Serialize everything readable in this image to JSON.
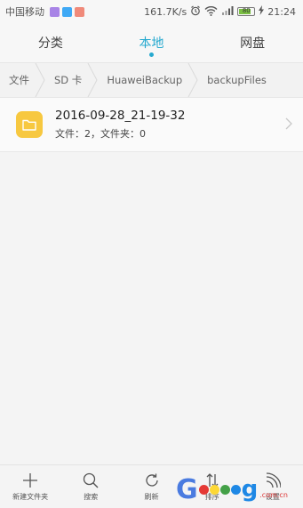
{
  "status_bar": {
    "carrier": "中国移动",
    "notification_colors": [
      "#a884e6",
      "#3fa9f5",
      "#f08a7a"
    ],
    "network_speed": "161.7K/s",
    "battery_level_text": "80",
    "battery_level": 0.8,
    "time": "21:24"
  },
  "tabs": {
    "items": [
      {
        "label": "分类"
      },
      {
        "label": "本地"
      },
      {
        "label": "网盘"
      }
    ],
    "active": "本地",
    "accent_color": "#26a9cf"
  },
  "breadcrumb": {
    "items": [
      "文件",
      "SD 卡",
      "HuaweiBackup",
      "backupFiles"
    ]
  },
  "files": [
    {
      "name": "2016-09-28_21-19-32",
      "meta": "文件：2，文件夹：0",
      "icon": "folder-icon",
      "icon_color": "#f7c840"
    }
  ],
  "toolbar": {
    "items": [
      {
        "label": "新建文件夹",
        "icon": "plus-icon"
      },
      {
        "label": "搜索",
        "icon": "search-icon"
      },
      {
        "label": "刷新",
        "icon": "refresh-icon"
      },
      {
        "label": "排序",
        "icon": "sort-icon"
      },
      {
        "label": "设置",
        "icon": "settings-icon"
      }
    ]
  },
  "watermark": {
    "text": "G",
    "dot_colors": [
      "#e53935",
      "#fdd835",
      "#43a047",
      "#1e88e5"
    ],
    "tail": "g",
    "suffix": ".com.cn"
  }
}
